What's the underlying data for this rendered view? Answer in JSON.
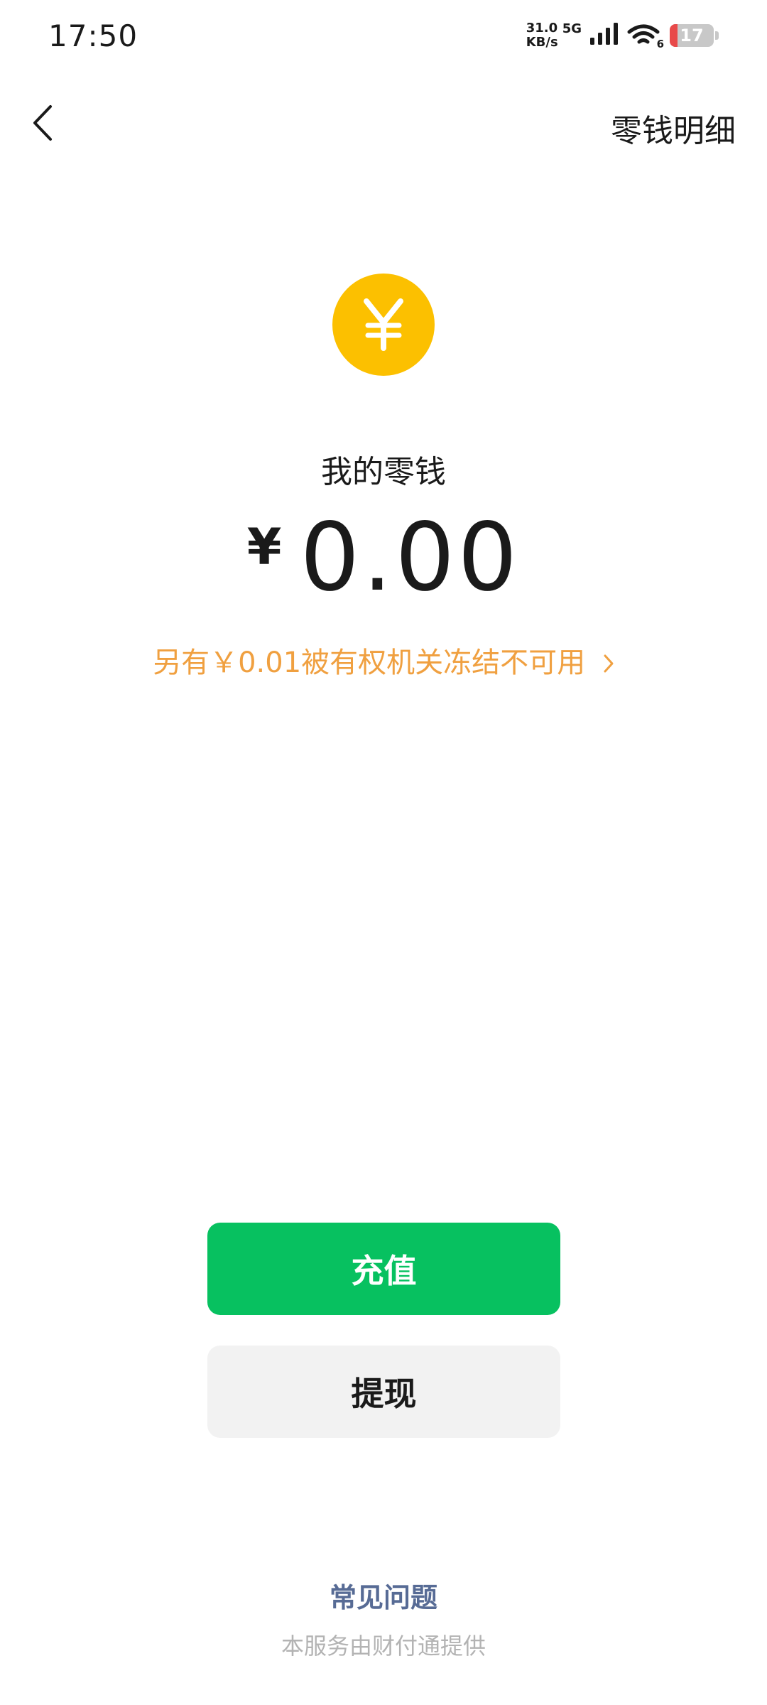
{
  "status_bar": {
    "time": "17:50",
    "net_speed_value": "31.0",
    "net_speed_unit": "KB/s",
    "network_type": "5G",
    "wifi_badge": "6",
    "battery_level": "17",
    "battery_fraction": 0.17,
    "battery_color": "#e84a4a"
  },
  "nav": {
    "back_icon": "chevron-left-icon",
    "detail_label": "零钱明细"
  },
  "wallet": {
    "coin_icon": "yuan-coin-icon",
    "coin_color": "#fcc000",
    "label": "我的零钱",
    "currency_symbol": "¥",
    "amount": "0.00",
    "frozen_notice": "另有￥0.01被有权机关冻结不可用",
    "frozen_color": "#f0a040"
  },
  "actions": {
    "recharge_label": "充值",
    "recharge_color": "#07c160",
    "withdraw_label": "提现"
  },
  "footer": {
    "faq_label": "常见问题",
    "provider_note": "本服务由财付通提供"
  }
}
